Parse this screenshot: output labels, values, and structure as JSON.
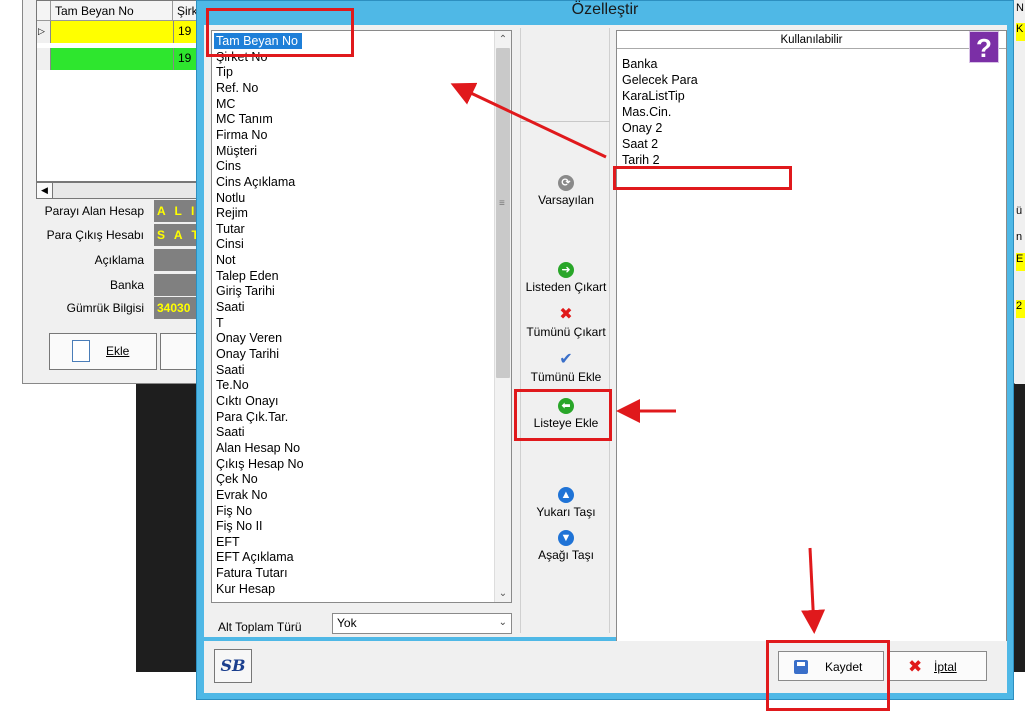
{
  "background": {
    "grid_headers": [
      "Tam Beyan No",
      "Şirk"
    ],
    "rows": [
      {
        "indicator": "▷",
        "number": "19"
      },
      {
        "indicator": "",
        "number": "19"
      }
    ],
    "fields": [
      {
        "label": "Parayı Alan Hesap",
        "value": "A L I"
      },
      {
        "label": "Para Çıkış Hesabı",
        "value": "S A T"
      },
      {
        "label": "Açıklama",
        "value": ""
      },
      {
        "label": "Banka",
        "value": ""
      },
      {
        "label": "Gümrük Bilgisi",
        "value": "34030"
      }
    ],
    "add_button": "Ekle",
    "right_fragments": [
      "N",
      "K",
      "ü",
      "n",
      "E",
      "2"
    ],
    "colors": {
      "highlight_yellow": "#ffff00",
      "row_green": "#2ee62e",
      "dark_panel": "#1e1e1e"
    }
  },
  "dialog": {
    "title": "Özelleştir",
    "columns": [
      "Tam Beyan No",
      "Şirket No",
      "Tip",
      "Ref. No",
      "MC",
      "MC Tanım",
      "Firma No",
      "Müşteri",
      "Cins",
      "Cins Açıklama",
      "Notlu",
      "Rejim",
      "Tutar",
      "Cinsi",
      "Not",
      "Talep Eden",
      "Giriş Tarihi",
      "Saati",
      "T",
      "Onay Veren",
      "Onay Tarihi",
      "Saati",
      "Te.No",
      "Cıktı Onayı",
      "Para Çık.Tar.",
      "Saati",
      "Alan Hesap No",
      "Çıkış Hesap No",
      "Çek No",
      "Evrak No",
      "Fiş No",
      "Fiş No II",
      "EFT",
      "EFT Açıklama",
      "Fatura Tutarı",
      "Kur Hesap"
    ],
    "selected_index": 0,
    "subtotal": {
      "label": "Alt Toplam Türü",
      "value": "Yok"
    },
    "middle_buttons": [
      {
        "label": "Varsayılan",
        "icon": "refresh-icon"
      },
      {
        "label": "Listeden Çıkart",
        "icon": "arrow-right-icon"
      },
      {
        "label": "Tümünü Çıkart",
        "icon": "x-icon"
      },
      {
        "label": "Tümünü Ekle",
        "icon": "check-icon"
      },
      {
        "label": "Listeye Ekle",
        "icon": "arrow-left-icon"
      },
      {
        "label": "Yukarı Taşı",
        "icon": "arrow-up-icon"
      },
      {
        "label": "Aşağı Taşı",
        "icon": "arrow-down-icon"
      }
    ],
    "available": {
      "header": "Kullanılabilir",
      "items": [
        "Banka",
        "Gelecek Para",
        "KaraListTip",
        "Mas.Cin.",
        "Onay 2",
        "Saat 2",
        "Tarih 2"
      ]
    },
    "help_label": "?",
    "logo_text": "SB",
    "save_label": "Kaydet",
    "cancel_label": "İptal",
    "colors": {
      "frame": "#4fb8e6",
      "selection": "#1e7fd8",
      "annotation": "#e0191c",
      "help": "#7b2fa6"
    }
  }
}
